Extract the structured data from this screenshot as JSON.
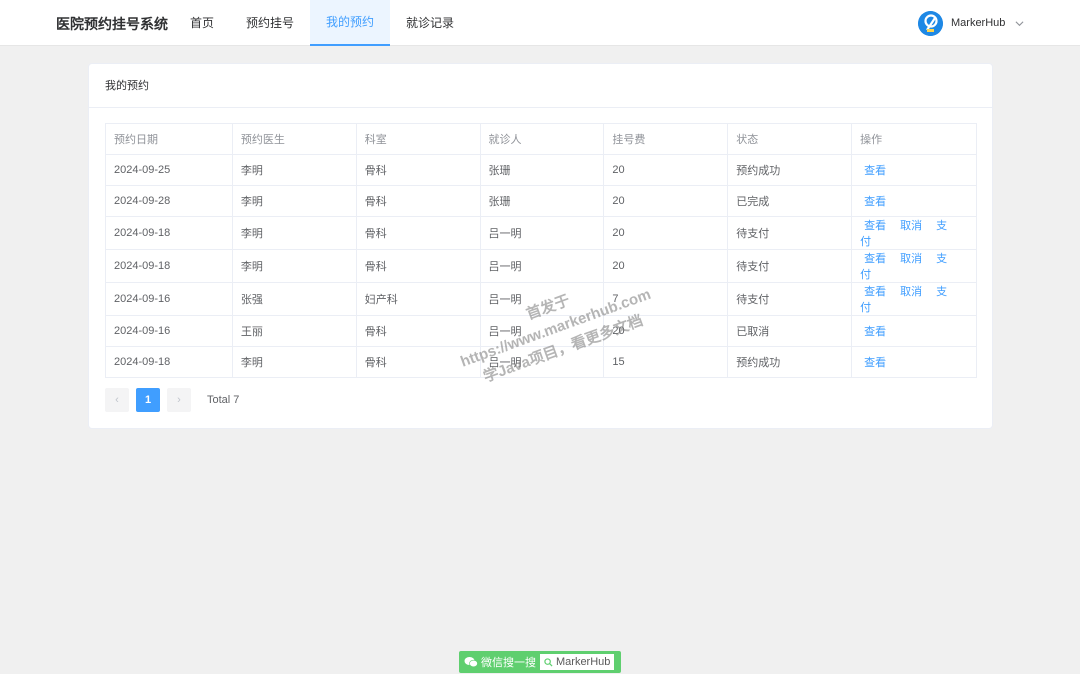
{
  "header": {
    "brand": "医院预约挂号系统",
    "nav": [
      "首页",
      "预约挂号",
      "我的预约",
      "就诊记录"
    ],
    "active_nav": "我的预约",
    "user_name": "MarkerHub",
    "accent": "#409eff"
  },
  "card": {
    "title": "我的预约",
    "columns": [
      "预约日期",
      "预约医生",
      "科室",
      "就诊人",
      "挂号费",
      "状态",
      "操作"
    ],
    "rows": [
      {
        "date": "2024-09-25",
        "doctor": "李明",
        "dept": "骨科",
        "patient": "张珊",
        "fee": "20",
        "status": "预约成功",
        "actions": [
          "查看"
        ]
      },
      {
        "date": "2024-09-28",
        "doctor": "李明",
        "dept": "骨科",
        "patient": "张珊",
        "fee": "20",
        "status": "已完成",
        "actions": [
          "查看"
        ]
      },
      {
        "date": "2024-09-18",
        "doctor": "李明",
        "dept": "骨科",
        "patient": "吕一明",
        "fee": "20",
        "status": "待支付",
        "actions": [
          "查看",
          "取消",
          "支付"
        ]
      },
      {
        "date": "2024-09-18",
        "doctor": "李明",
        "dept": "骨科",
        "patient": "吕一明",
        "fee": "20",
        "status": "待支付",
        "actions": [
          "查看",
          "取消",
          "支付"
        ]
      },
      {
        "date": "2024-09-16",
        "doctor": "张强",
        "dept": "妇产科",
        "patient": "吕一明",
        "fee": "7",
        "status": "待支付",
        "actions": [
          "查看",
          "取消",
          "支付"
        ]
      },
      {
        "date": "2024-09-16",
        "doctor": "王丽",
        "dept": "骨科",
        "patient": "吕一明",
        "fee": "20",
        "status": "已取消",
        "actions": [
          "查看"
        ]
      },
      {
        "date": "2024-09-18",
        "doctor": "李明",
        "dept": "骨科",
        "patient": "吕一明",
        "fee": "15",
        "status": "预约成功",
        "actions": [
          "查看"
        ]
      }
    ]
  },
  "pagination": {
    "prev": "‹",
    "current_page": "1",
    "next": "›",
    "total_label": "Total 7"
  },
  "watermark": {
    "line1": "首发于",
    "line2": "https://www.markerhub.com",
    "line3": "学Java项目，看更多文档"
  },
  "badge": {
    "left_text": "微信搜一搜",
    "search_text": "MarkerHub",
    "color": "#5fcf6f"
  }
}
